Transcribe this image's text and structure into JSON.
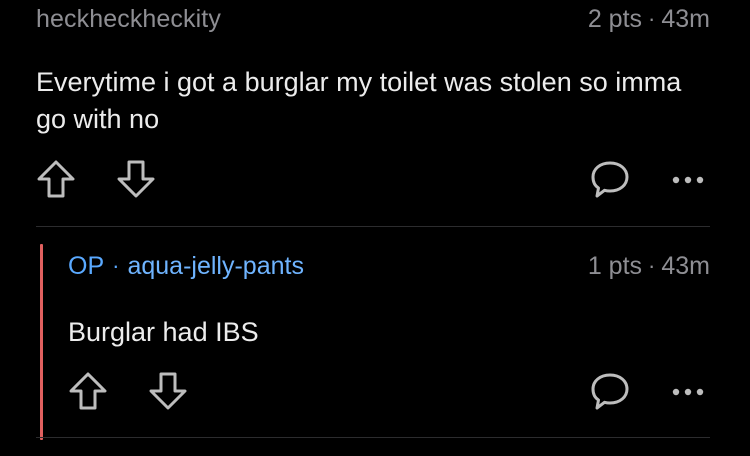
{
  "comment": {
    "username": "heckheckheckity",
    "points": "2 pts",
    "age": "43m",
    "text": "Everytime i got a burglar my toilet was stolen so imma go with no"
  },
  "reply": {
    "op_label": "OP",
    "username": "aqua-jelly-pants",
    "points": "1 pts",
    "age": "43m",
    "text": "Burglar had IBS"
  },
  "separator": "·",
  "colors": {
    "background": "#000000",
    "meta_text": "#8e8e93",
    "op_accent": "#5aa9ff",
    "thread_bar": "#e0605f",
    "icon": "#bdbdbd"
  },
  "icons": [
    "upvote-icon",
    "downvote-icon",
    "reply-icon",
    "more-options-icon"
  ]
}
